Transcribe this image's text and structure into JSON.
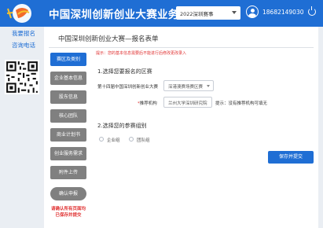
{
  "header": {
    "title": "中国深圳创新创业大赛业务系",
    "season_select": "2022深圳赛事",
    "phone": "18682149030",
    "colors": {
      "primary": "#1f6ed4",
      "warning": "#e03030",
      "step_inactive": "#808080"
    }
  },
  "sidebar": {
    "links": [
      {
        "label": "我要报名"
      },
      {
        "label": "咨询电话"
      }
    ]
  },
  "form": {
    "page_title": "中国深圳创新创业大赛—报名表单",
    "hint": "提示：您的基本信息需要后不能进行后修改更改录入",
    "section1_title": "1.选择您要报名的区赛",
    "field1_label": "第十四届中国深圳创新创业大赛",
    "field1_value": "深港澳赛场赛区赛",
    "field2_req": "*",
    "field2_label": "推荐机构",
    "field2_value": "兰州大学深圳研究院",
    "field2_hint": "提示：没有推荐机构可填无",
    "section2_title": "2.选择您的参赛组别",
    "radio1_label": "企业组",
    "radio2_label": "团队组",
    "save_label": "保存并提交"
  },
  "steps": [
    {
      "label": "赛区及类别",
      "active": true
    },
    {
      "label": "企业基本信息",
      "active": false
    },
    {
      "label": "股东信息",
      "active": false
    },
    {
      "label": "核心团队",
      "active": false
    },
    {
      "label": "商业计划书",
      "active": false
    },
    {
      "label": "创业服务需求",
      "active": false
    },
    {
      "label": "附件上传",
      "active": false
    }
  ],
  "confirm_label": "确认申报",
  "warning_line1": "请确认所有页面均",
  "warning_line2": "已保存并提交"
}
